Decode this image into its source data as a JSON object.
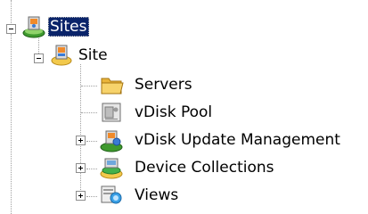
{
  "tree": {
    "root": {
      "label": "Sites",
      "expanded": true,
      "selected": true,
      "icon": "sites-icon"
    },
    "site": {
      "label": "Site",
      "expanded": true,
      "icon": "site-icon"
    },
    "children": [
      {
        "label": "Servers",
        "icon": "folder-icon",
        "expander": "none"
      },
      {
        "label": "vDisk Pool",
        "icon": "vdisk-pool-icon",
        "expander": "none"
      },
      {
        "label": "vDisk Update Management",
        "icon": "update-management-icon",
        "expander": "collapsed"
      },
      {
        "label": "Device Collections",
        "icon": "device-collections-icon",
        "expander": "collapsed"
      },
      {
        "label": "Views",
        "icon": "views-icon",
        "expander": "collapsed"
      }
    ]
  }
}
